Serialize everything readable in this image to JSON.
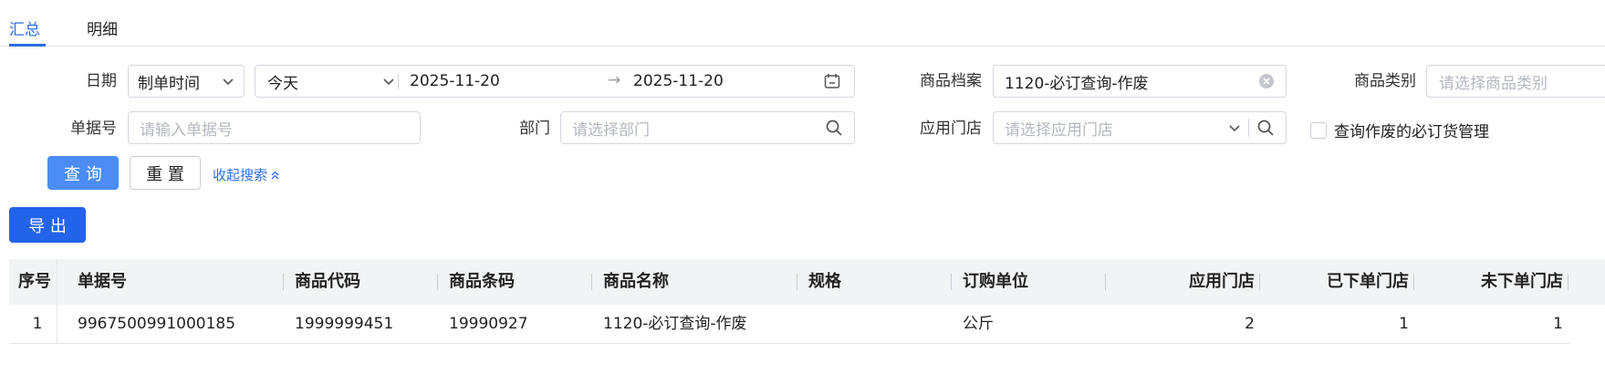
{
  "tabs": [
    {
      "label": "汇总",
      "active": true
    },
    {
      "label": "明细",
      "active": false
    }
  ],
  "filters": {
    "date_label": "日期",
    "date_type": "制单时间",
    "date_preset": "今天",
    "date_start": "2025-11-20",
    "date_end": "2025-11-20",
    "date_arrow": "→",
    "product_archive_label": "商品档案",
    "product_archive_value": "1120-必订查询-作废",
    "product_category_label": "商品类别",
    "product_category_placeholder": "请选择商品类别",
    "doc_no_label": "单据号",
    "doc_no_placeholder": "请输入单据号",
    "department_label": "部门",
    "department_placeholder": "请选择部门",
    "apply_store_label": "应用门店",
    "apply_store_placeholder": "请选择应用门店",
    "voided_checkbox_label": "查询作废的必订货管理",
    "voided_checked": false
  },
  "actions": {
    "query": "查 询",
    "reset": "重 置",
    "collapse": "收起搜索",
    "export": "导 出"
  },
  "table": {
    "columns": [
      "序号",
      "单据号",
      "商品代码",
      "商品条码",
      "商品名称",
      "规格",
      "订购单位",
      "应用门店",
      "已下单门店",
      "未下单门店"
    ],
    "rows": [
      {
        "index": "1",
        "doc_no": "9967500991000185",
        "product_code": "1999999451",
        "barcode": "19990927",
        "product_name": "1120-必订查询-作废",
        "spec": "",
        "unit": "公斤",
        "apply_stores": "2",
        "ordered_stores": "1",
        "not_ordered_stores": "1"
      }
    ]
  },
  "colors": {
    "primary": "#2f6ee6",
    "query_button": "#4b8df5",
    "export_button": "#2363e9",
    "header_bg": "#f2f3f5"
  },
  "icons": [
    "chevron-down-icon",
    "calendar-icon",
    "clear-icon",
    "search-icon",
    "double-chevron-up-icon"
  ]
}
